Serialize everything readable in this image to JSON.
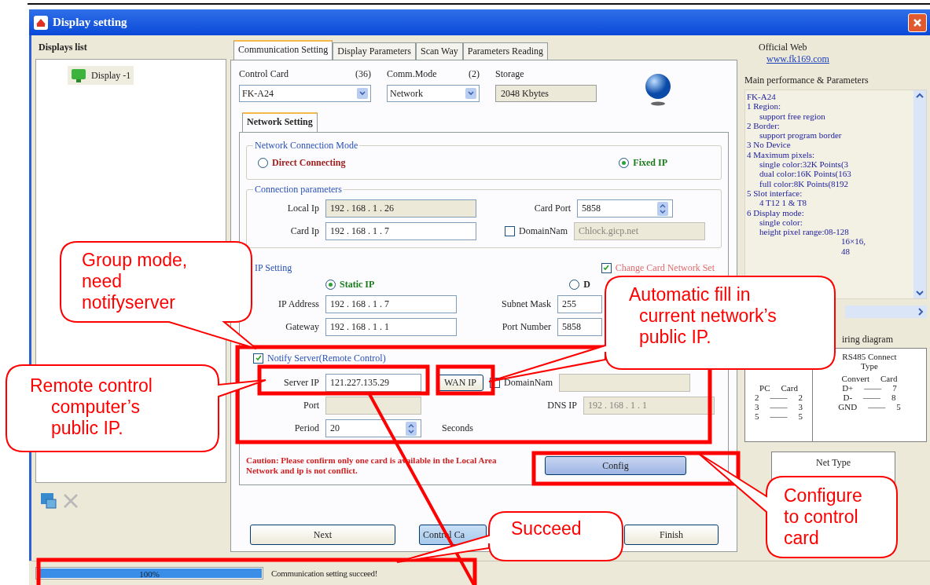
{
  "window": {
    "title": "Display setting"
  },
  "displays_list": {
    "title": "Displays list",
    "items": [
      {
        "label": "Display -1",
        "selected": true
      }
    ]
  },
  "tabs": [
    {
      "label": "Communication Setting",
      "selected": true
    },
    {
      "label": "Display Parameters",
      "selected": false
    },
    {
      "label": "Scan Way",
      "selected": false
    },
    {
      "label": "Parameters Reading",
      "selected": false
    }
  ],
  "control_card": {
    "label": "Control Card",
    "count": "(36)",
    "value": "FK-A24"
  },
  "comm_mode": {
    "label": "Comm.Mode",
    "count": "(2)",
    "value": "Network"
  },
  "storage": {
    "label": "Storage",
    "value": "2048 Kbytes"
  },
  "sub_tabs": [
    {
      "label": "Network Setting",
      "selected": true
    }
  ],
  "connection_mode": {
    "title": "Network Connection Mode",
    "options": [
      {
        "label": "Direct Connecting",
        "selected": false
      },
      {
        "label": "Fixed IP",
        "selected": true
      }
    ]
  },
  "connection_parameters": {
    "title": "Connection parameters",
    "local_ip": {
      "label": "Local Ip",
      "value": "192 . 168 . 1 . 26"
    },
    "card_port": {
      "label": "Card Port",
      "value": "5858"
    },
    "card_ip": {
      "label": "Card Ip",
      "value": "192 . 168 . 1 . 7"
    },
    "domain": {
      "label": "DomainNam",
      "checked": false,
      "value": "Chlock.gicp.net"
    }
  },
  "ip_setting": {
    "title": "IP Setting",
    "modes": [
      {
        "label": "Static IP",
        "selected": true
      },
      {
        "label": "D",
        "selected": false
      }
    ],
    "change_card_network_set": {
      "label": "Change Card Network Set",
      "checked": true
    },
    "ip_address": {
      "label": "IP Address",
      "value": "192 . 168 . 1 . 7"
    },
    "subnet_mask": {
      "label": "Subnet Mask",
      "value": "255"
    },
    "gateway": {
      "label": "Gateway",
      "value": "192 . 168 . 1 . 1"
    },
    "port_number": {
      "label": "Port Number",
      "value": "5858"
    }
  },
  "notify_server": {
    "label": "Notify Server(Remote Control)",
    "checked": true,
    "server_ip": {
      "label": "Server IP",
      "value": "121.227.135.29"
    },
    "wan_ip_button": "WAN IP",
    "domain": {
      "label": "DomainNam",
      "checked": false
    },
    "port": {
      "label": "Port"
    },
    "dns_ip": {
      "label": "DNS IP",
      "value": "192 . 168 . 1 . 1"
    },
    "period": {
      "label": "Period",
      "value": "20",
      "unit": "Seconds"
    }
  },
  "caution": "Caution: Please confirm only one card is available in the Local Area Network and ip is not conflict.",
  "config_button": "Config",
  "buttons": [
    "Next",
    "Control Ca",
    "Finish"
  ],
  "official_web": {
    "label": "Official Web",
    "link": "www.fk169.com"
  },
  "parameters": {
    "title": "Main performance & Parameters",
    "lines": [
      {
        "text": "FK-A24",
        "kind": "head"
      },
      {
        "text": "1 Region:",
        "kind": "head"
      },
      {
        "text": "support free region",
        "kind": "sub"
      },
      {
        "text": "2 Border:",
        "kind": "head"
      },
      {
        "text": "support program border",
        "kind": "sub"
      },
      {
        "text": "3 No Device",
        "kind": "head"
      },
      {
        "text": "4 Maximum pixels:",
        "kind": "head"
      },
      {
        "text": "single color:32K Points(3",
        "kind": "sub"
      },
      {
        "text": "dual color:16K Points(163",
        "kind": "sub"
      },
      {
        "text": "full color:8K Points(8192",
        "kind": "sub"
      },
      {
        "text": "5 Slot interface:",
        "kind": "head"
      },
      {
        "text": "4 T12 1 & T8",
        "kind": "sub"
      },
      {
        "text": "6 Display mode:",
        "kind": "head"
      },
      {
        "text": "single color:",
        "kind": "sub"
      },
      {
        "text": "height pixel range:08-128",
        "kind": "sub"
      },
      {
        "text": "16×16,",
        "kind": "fragment"
      },
      {
        "text": "48",
        "kind": "fragment"
      }
    ]
  },
  "wiring": {
    "title": "iring diagram",
    "rs232": {
      "header": [
        "PC",
        "Card"
      ],
      "rows": [
        [
          "2",
          "——",
          "2"
        ],
        [
          "3",
          "——",
          "3"
        ],
        [
          "5",
          "——",
          "5"
        ]
      ]
    },
    "rs485": {
      "title": "RS485 Connect Type",
      "header": [
        "Convert",
        "Card"
      ],
      "rows": [
        [
          "D+",
          "——",
          "7"
        ],
        [
          "D-",
          "——",
          "8"
        ],
        [
          "GND",
          "——",
          "5"
        ]
      ]
    }
  },
  "net_type": "Net Type",
  "status_bar": {
    "progress": {
      "level": 1,
      "label": "100%"
    },
    "message": "Communication setting succeed!"
  },
  "callouts": [
    {
      "lines": [
        "Group mode,",
        "need",
        "notifyserver"
      ]
    },
    {
      "lines": [
        "Remote control",
        "computer’s",
        "public IP."
      ]
    },
    {
      "lines": [
        "Automatic fill in",
        "current network’s",
        "public IP."
      ]
    },
    {
      "lines": [
        "Configure",
        "to control",
        "card"
      ]
    },
    {
      "lines": [
        "Succeed"
      ]
    }
  ]
}
